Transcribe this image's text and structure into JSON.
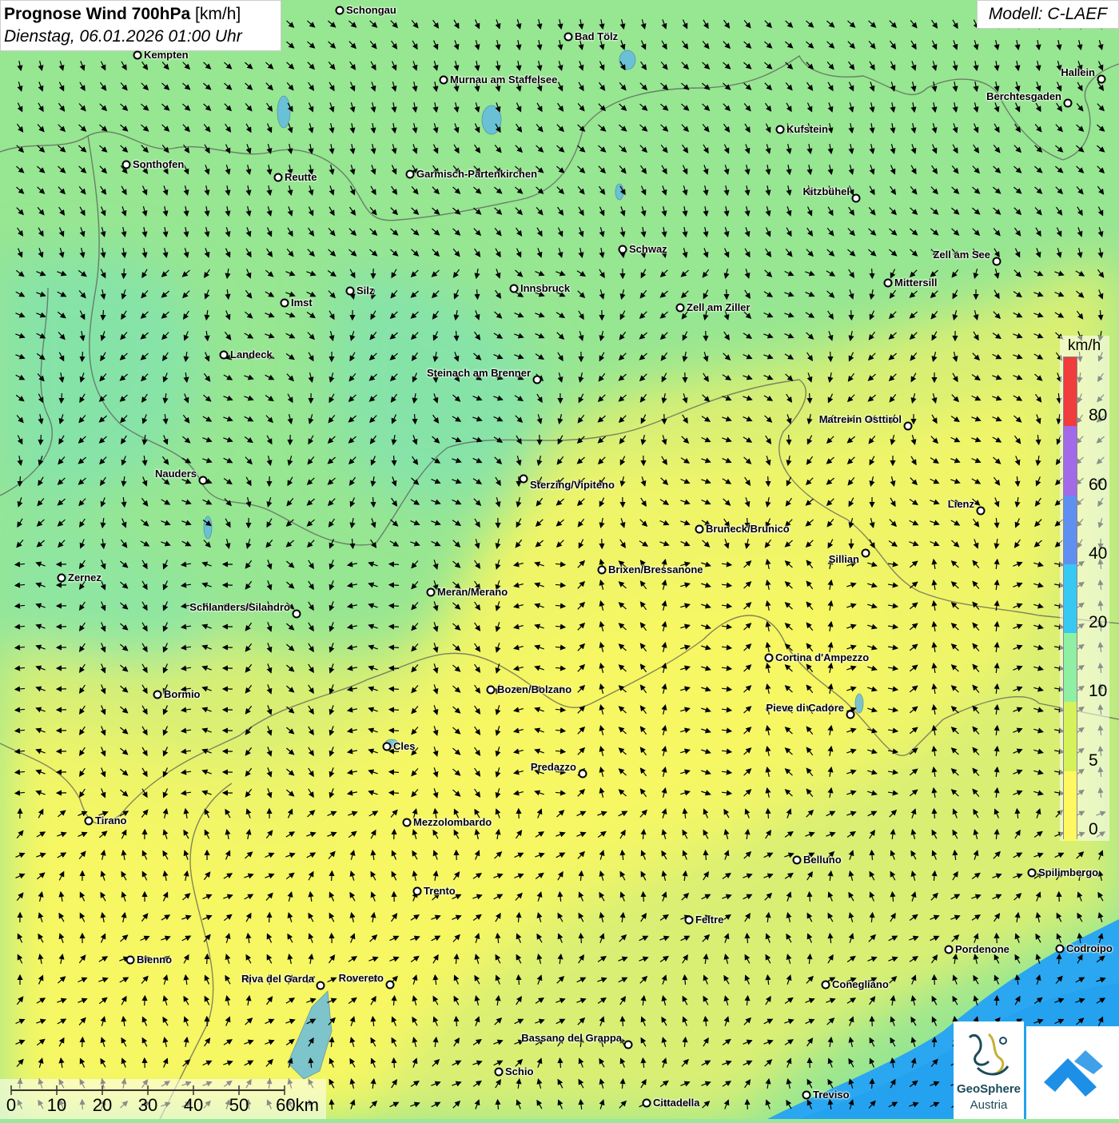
{
  "header": {
    "title_bold": "Prognose Wind 700hPa",
    "title_unit": "[km/h]",
    "datetime": "Dienstag, 06.01.2026 01:00 Uhr"
  },
  "model": "Modell: C-LAEF",
  "legend": {
    "unit": "km/h",
    "labels": [
      "80",
      "60",
      "40",
      "20",
      "10",
      "5",
      "0"
    ],
    "colors": [
      "#f03c3c",
      "#a269e8",
      "#5f8ff0",
      "#38c8f4",
      "#8ff0a4",
      "#d6f25a",
      "#fff860"
    ]
  },
  "scalebar": {
    "labels": [
      "0",
      "10",
      "20",
      "30",
      "40",
      "50",
      "60km"
    ]
  },
  "logos": {
    "geosphere_name": "GeoSphere",
    "geosphere_sub": "Austria"
  },
  "cities": [
    {
      "name": "Schongau"
    },
    {
      "name": "Bad Tölz"
    },
    {
      "name": "Kempten"
    },
    {
      "name": "Murnau am Staffelsee"
    },
    {
      "name": "Hallein"
    },
    {
      "name": "Berchtesgaden"
    },
    {
      "name": "Kufstein"
    },
    {
      "name": "Sonthofen"
    },
    {
      "name": "Reutte"
    },
    {
      "name": "Garmisch-Partenkirchen"
    },
    {
      "name": "Kitzbühel"
    },
    {
      "name": "Schwaz"
    },
    {
      "name": "Zell am See"
    },
    {
      "name": "Innsbruck"
    },
    {
      "name": "Mittersill"
    },
    {
      "name": "Silz"
    },
    {
      "name": "Imst"
    },
    {
      "name": "Zell am Ziller"
    },
    {
      "name": "Landeck"
    },
    {
      "name": "Steinach am Brenner"
    },
    {
      "name": "Matrei in Osttirol"
    },
    {
      "name": "Nauders"
    },
    {
      "name": "Sterzing/Vipiteno"
    },
    {
      "name": "Lienz"
    },
    {
      "name": "Bruneck/Brunico"
    },
    {
      "name": "Sillian"
    },
    {
      "name": "Brixen/Bressanone"
    },
    {
      "name": "Zernez"
    },
    {
      "name": "Meran/Merano"
    },
    {
      "name": "Schlanders/Silandro"
    },
    {
      "name": "Cortina d'Ampezzo"
    },
    {
      "name": "Bozen/Bolzano"
    },
    {
      "name": "Bormio"
    },
    {
      "name": "Pieve di Cadore"
    },
    {
      "name": "Cles"
    },
    {
      "name": "Predazzo"
    },
    {
      "name": "Tirano"
    },
    {
      "name": "Mezzolombardo"
    },
    {
      "name": "Belluno"
    },
    {
      "name": "Spilimbergo"
    },
    {
      "name": "Trento"
    },
    {
      "name": "Feltre"
    },
    {
      "name": "Pordenone"
    },
    {
      "name": "Codroipo"
    },
    {
      "name": "Bienno"
    },
    {
      "name": "Riva del Garda"
    },
    {
      "name": "Rovereto"
    },
    {
      "name": "Conegliano"
    },
    {
      "name": "Bassano del Grappa"
    },
    {
      "name": "Schio"
    },
    {
      "name": "Treviso"
    },
    {
      "name": "Cittadella"
    }
  ]
}
